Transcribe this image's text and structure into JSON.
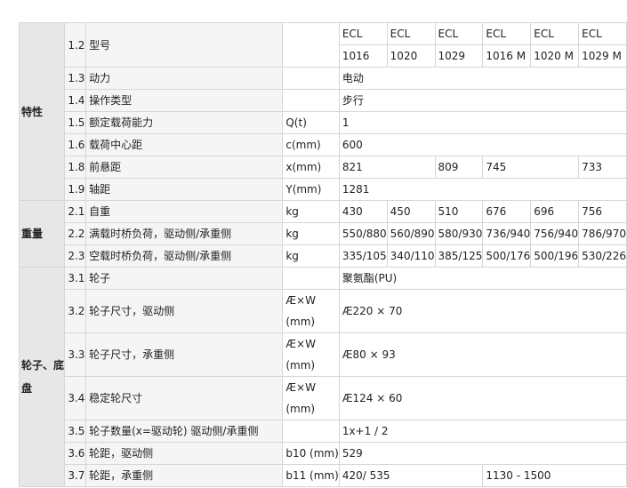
{
  "sections": {
    "characteristics": "特性",
    "weight": "重量",
    "wheels": "轮子、底盘"
  },
  "rows": {
    "r1_2": {
      "num": "1.2",
      "label": "型号",
      "unit": "",
      "models_top": [
        "ECL",
        "ECL",
        "ECL",
        "ECL",
        "ECL",
        "ECL"
      ],
      "models_bottom": [
        "1016",
        "1020",
        "1029",
        "1016 M",
        "1020 M",
        "1029 M"
      ]
    },
    "r1_3": {
      "num": "1.3",
      "label": "动力",
      "unit": "",
      "value": "电动"
    },
    "r1_4": {
      "num": "1.4",
      "label": "操作类型",
      "unit": "",
      "value": "步行"
    },
    "r1_5": {
      "num": "1.5",
      "label": "额定载荷能力",
      "unit": "Q(t)",
      "value": "1"
    },
    "r1_6": {
      "num": "1.6",
      "label": "载荷中心距",
      "unit": "c(mm)",
      "value": "600"
    },
    "r1_8": {
      "num": "1.8",
      "label": "前悬距",
      "unit": "x(mm)",
      "values": [
        "821",
        "809",
        "745",
        "733"
      ]
    },
    "r1_9": {
      "num": "1.9",
      "label": "轴距",
      "unit": "Y(mm)",
      "value": "1281"
    },
    "r2_1": {
      "num": "2.1",
      "label": "自重",
      "unit": "kg",
      "values": [
        "430",
        "450",
        "510",
        "676",
        "696",
        "756"
      ]
    },
    "r2_2": {
      "num": "2.2",
      "label": "满载时桥负荷，驱动侧/承重侧",
      "unit": "kg",
      "values": [
        "550/880",
        "560/890",
        "580/930",
        "736/940",
        "756/940",
        "786/970"
      ]
    },
    "r2_3": {
      "num": "2.3",
      "label": "空载时桥负荷，驱动侧/承重侧",
      "unit": "kg",
      "values": [
        "335/105",
        "340/110",
        "385/125",
        "500/176",
        "500/196",
        "530/226"
      ]
    },
    "r3_1": {
      "num": "3.1",
      "label": "轮子",
      "unit": "",
      "value": "聚氨酯(PU)"
    },
    "r3_2": {
      "num": "3.2",
      "label": "轮子尺寸，驱动侧",
      "unit_top": "Æ×W",
      "unit_bottom": "(mm)",
      "value": "Æ220 × 70"
    },
    "r3_3": {
      "num": "3.3",
      "label": "轮子尺寸，承重侧",
      "unit_top": "Æ×W",
      "unit_bottom": "(mm)",
      "value": "Æ80 × 93"
    },
    "r3_4": {
      "num": "3.4",
      "label": "稳定轮尺寸",
      "unit_top": "Æ×W",
      "unit_bottom": "(mm)",
      "value": "Æ124 × 60"
    },
    "r3_5": {
      "num": "3.5",
      "label": "轮子数量(x=驱动轮)  驱动侧/承重侧",
      "unit": "",
      "value": "1x+1 / 2"
    },
    "r3_6": {
      "num": "3.6",
      "label": "轮距，驱动侧",
      "unit": "b10 (mm)",
      "value": "529"
    },
    "r3_7": {
      "num": "3.7",
      "label": "轮距，承重侧",
      "unit": "b11 (mm)",
      "values": [
        "420/ 535",
        "1130 - 1500"
      ]
    }
  }
}
